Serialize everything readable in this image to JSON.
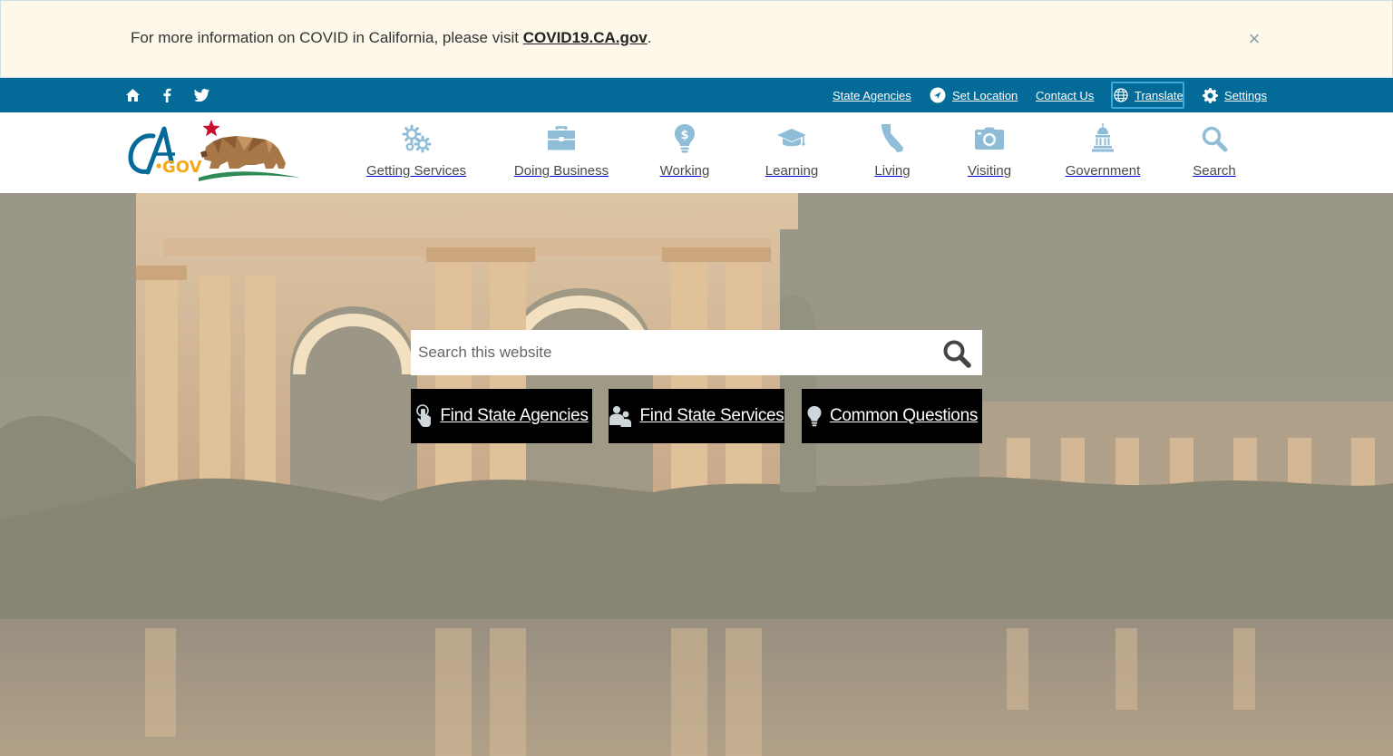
{
  "alert": {
    "text": "For more information on COVID in California, please visit ",
    "link_text": "COVID19.CA.gov",
    "suffix": ".",
    "close_label": "×"
  },
  "utility_bar": {
    "social": [
      {
        "name": "home",
        "icon": "home-icon"
      },
      {
        "name": "facebook",
        "icon": "facebook-icon"
      },
      {
        "name": "twitter",
        "icon": "twitter-icon"
      }
    ],
    "state_agencies": "State Agencies",
    "set_location": "Set Location",
    "contact_us": "Contact Us",
    "translate": "Translate",
    "settings": "Settings"
  },
  "nav": {
    "items": [
      {
        "label": "Getting Services",
        "icon": "gears-icon"
      },
      {
        "label": "Doing Business",
        "icon": "briefcase-icon"
      },
      {
        "label": "Working",
        "icon": "lightbulb-dollar-icon"
      },
      {
        "label": "Learning",
        "icon": "graduation-cap-icon"
      },
      {
        "label": "Living",
        "icon": "california-icon"
      },
      {
        "label": "Visiting",
        "icon": "camera-icon"
      },
      {
        "label": "Government",
        "icon": "capitol-icon"
      },
      {
        "label": "Search",
        "icon": "search-icon"
      }
    ]
  },
  "hero": {
    "search_placeholder": "Search this website",
    "buttons": {
      "agencies": "Find State Agencies",
      "services": "Find State Services",
      "questions": "Common Questions"
    }
  },
  "colors": {
    "utility_bar": "#046b99",
    "alert_bg": "#fdf8ea",
    "nav_icon": "#8fbcd6",
    "button_bg": "#000000"
  }
}
